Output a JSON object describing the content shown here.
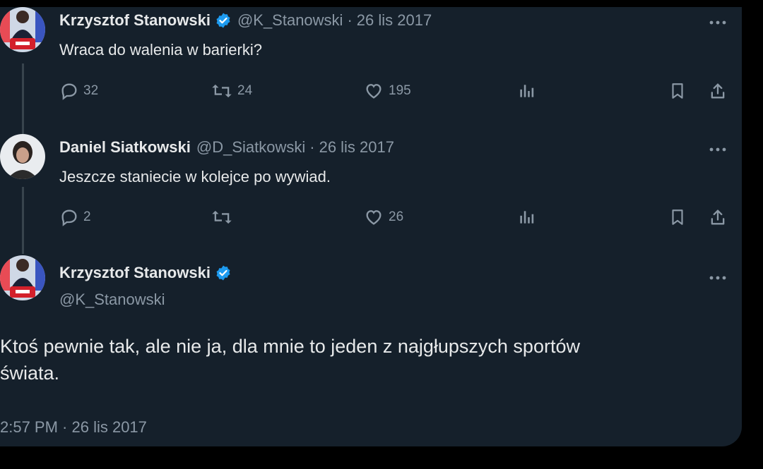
{
  "colors": {
    "background": "#15202b",
    "text": "#e7e9ea",
    "secondary": "#8b98a5",
    "verified": "#1d9bf0",
    "thread_line": "#38444d"
  },
  "tweets": [
    {
      "author": "Krzysztof Stanowski",
      "handle": "@K_Stanowski",
      "separator": "·",
      "date": "26 lis 2017",
      "text": "Wraca do walenia w barierki?",
      "verified": true,
      "actions": {
        "replies": "32",
        "retweets": "24",
        "likes": "195",
        "views": ""
      }
    },
    {
      "author": "Daniel Siatkowski",
      "handle": "@D_Siatkowski",
      "separator": "·",
      "date": "26 lis 2017",
      "text": "Jeszcze staniecie w kolejce po wywiad.",
      "verified": false,
      "actions": {
        "replies": "2",
        "retweets": "",
        "likes": "26",
        "views": ""
      }
    }
  ],
  "main_tweet": {
    "author": "Krzysztof Stanowski",
    "handle": "@K_Stanowski",
    "verified": true,
    "text_line1": "Ktoś pewnie tak, ale nie ja, dla mnie to jeden z najgłupszych sportów",
    "text_line2": "świata.",
    "timestamp": "2:57 PM · 26 lis 2017"
  },
  "icons": [
    "reply-icon",
    "retweet-icon",
    "like-icon",
    "analytics-icon",
    "bookmark-icon",
    "share-icon",
    "more-icon",
    "verified-badge-icon"
  ]
}
